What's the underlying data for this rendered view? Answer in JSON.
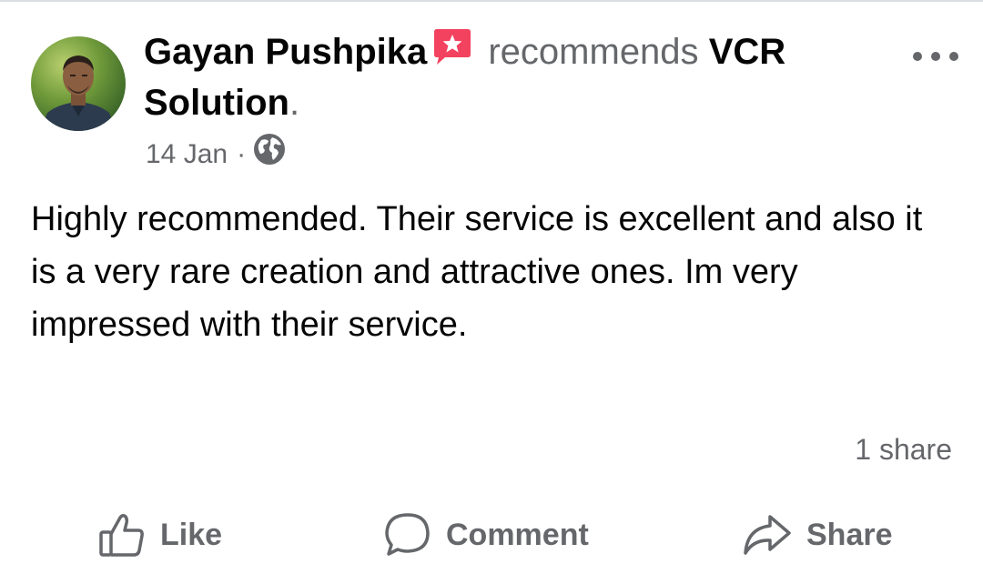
{
  "post": {
    "author": "Gayan Pushpika",
    "verb": "recommends",
    "page_name": "VCR Solution",
    "period": ".",
    "date": "14 Jan",
    "separator": "·",
    "privacy_icon": "globe-icon",
    "recommend_icon": "recommendation-badge-icon",
    "text": "Highly recommended. Their service is excellent and also it is a very rare creation and attractive ones. Im very impressed with their service.",
    "share_count": "1 share"
  },
  "actions": {
    "like_label": "Like",
    "comment_label": "Comment",
    "share_label": "Share"
  },
  "colors": {
    "primary_text": "#050505",
    "secondary_text": "#65676b",
    "recommend_badge": "#f3425f"
  }
}
